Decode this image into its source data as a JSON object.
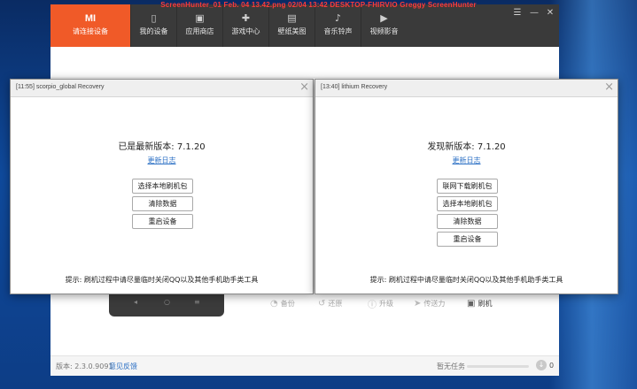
{
  "watermark": "ScreenHunter_01 Feb. 04 13.42.png   02/04   13:42   DESKTOP-FHIRVIO   Greggy   ScreenHunter",
  "app": {
    "brand": {
      "logo": "MI",
      "label": "请连接设备"
    },
    "nav": [
      {
        "label": "我的设备",
        "icon": "phone-icon"
      },
      {
        "label": "应用商店",
        "icon": "bag-icon"
      },
      {
        "label": "游戏中心",
        "icon": "gamepad-icon"
      },
      {
        "label": "壁纸美图",
        "icon": "picture-icon"
      },
      {
        "label": "音乐铃声",
        "icon": "music-icon"
      },
      {
        "label": "视频影音",
        "icon": "video-icon"
      }
    ],
    "actions": {
      "backup": "备份",
      "restore": "还原",
      "upgrade": "升级",
      "send": "传送力",
      "flash": "刷机"
    },
    "footer": {
      "version": "版本: 2.3.0.9091",
      "feedback": "意见反馈",
      "tasks": "暂无任务",
      "count": "0"
    }
  },
  "dialogs": {
    "left": {
      "title": "[11:55] scorpio_global Recovery",
      "version": "已是最新版本: 7.1.20",
      "changelog": "更新日志",
      "buttons": [
        "选择本地刷机包",
        "清除数据",
        "重启设备"
      ],
      "hint": "提示: 刷机过程中请尽量临时关闭QQ以及其他手机助手类工具"
    },
    "right": {
      "title": "[13:40] lithium Recovery",
      "version": "发现新版本: 7.1.20",
      "changelog": "更新日志",
      "buttons": [
        "联网下载刷机包",
        "选择本地刷机包",
        "清除数据",
        "重启设备"
      ],
      "hint": "提示: 刷机过程中请尽量临时关闭QQ以及其他手机助手类工具"
    }
  },
  "colors": {
    "brand": "#f05a28",
    "topbar": "#3a3a3a",
    "link": "#2a6fc4"
  }
}
